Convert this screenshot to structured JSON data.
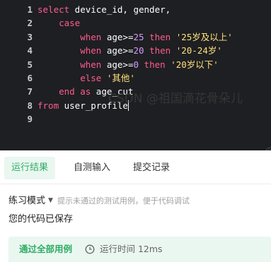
{
  "editor": {
    "lines": [
      {
        "num": "1",
        "tokens": [
          {
            "t": "select",
            "c": "kw"
          },
          {
            "t": " device_id, gender,",
            "c": ""
          }
        ]
      },
      {
        "num": "2",
        "tokens": [
          {
            "t": "    ",
            "c": ""
          },
          {
            "t": "case",
            "c": "kw"
          }
        ]
      },
      {
        "num": "3",
        "tokens": [
          {
            "t": "        ",
            "c": ""
          },
          {
            "t": "when",
            "c": "kw"
          },
          {
            "t": " age>=",
            "c": ""
          },
          {
            "t": "25",
            "c": "num"
          },
          {
            "t": " ",
            "c": ""
          },
          {
            "t": "then",
            "c": "kw"
          },
          {
            "t": " ",
            "c": ""
          },
          {
            "t": "'25岁及以上'",
            "c": "str"
          }
        ]
      },
      {
        "num": "4",
        "tokens": [
          {
            "t": "        ",
            "c": ""
          },
          {
            "t": "when",
            "c": "kw"
          },
          {
            "t": " age>=",
            "c": ""
          },
          {
            "t": "20",
            "c": "num"
          },
          {
            "t": " ",
            "c": ""
          },
          {
            "t": "then",
            "c": "kw"
          },
          {
            "t": " ",
            "c": ""
          },
          {
            "t": "'20-24岁'",
            "c": "str"
          }
        ]
      },
      {
        "num": "5",
        "tokens": [
          {
            "t": "        ",
            "c": ""
          },
          {
            "t": "when",
            "c": "kw"
          },
          {
            "t": " age>=",
            "c": ""
          },
          {
            "t": "0",
            "c": "num"
          },
          {
            "t": " ",
            "c": ""
          },
          {
            "t": "then",
            "c": "kw"
          },
          {
            "t": " ",
            "c": ""
          },
          {
            "t": "'20岁以下'",
            "c": "str"
          }
        ]
      },
      {
        "num": "6",
        "tokens": [
          {
            "t": "        ",
            "c": ""
          },
          {
            "t": "else",
            "c": "kw"
          },
          {
            "t": " ",
            "c": ""
          },
          {
            "t": "'其他'",
            "c": "str"
          }
        ]
      },
      {
        "num": "7",
        "tokens": [
          {
            "t": "    ",
            "c": ""
          },
          {
            "t": "end",
            "c": "kw"
          },
          {
            "t": " ",
            "c": ""
          },
          {
            "t": "as",
            "c": "kw"
          },
          {
            "t": " age_cut",
            "c": ""
          }
        ]
      },
      {
        "num": "8",
        "cursor": true,
        "tokens": [
          {
            "t": "from",
            "c": "kw"
          },
          {
            "t": " user_profile",
            "c": ""
          }
        ]
      },
      {
        "num": "9",
        "tokens": []
      }
    ],
    "scroll_toggle_icon": "chevron-down-icon"
  },
  "panel": {
    "tabs": [
      {
        "label": "运行结果",
        "active": true
      },
      {
        "label": "自测输入",
        "active": false
      },
      {
        "label": "提交记录",
        "active": false
      }
    ],
    "mode": {
      "label": "练习模式",
      "caret_icon": "caret-down-icon",
      "hint": "提示未通过的测试用例，便于代码调试"
    },
    "saved_text": "您的代码已保存",
    "result": {
      "pass_text": "通过全部用例",
      "runtime_text": "运行时间 12ms",
      "clock_icon": "clock-icon"
    },
    "watermark": "CSDN @祖国滴花骨朵儿"
  },
  "colors": {
    "editor_bg": "#1e1f22",
    "keyword": "#ff5c8d",
    "number": "#d49bff",
    "string": "#ffe17a",
    "accent_green": "#2ead65",
    "accent_green_bg": "#eaf7f0"
  }
}
